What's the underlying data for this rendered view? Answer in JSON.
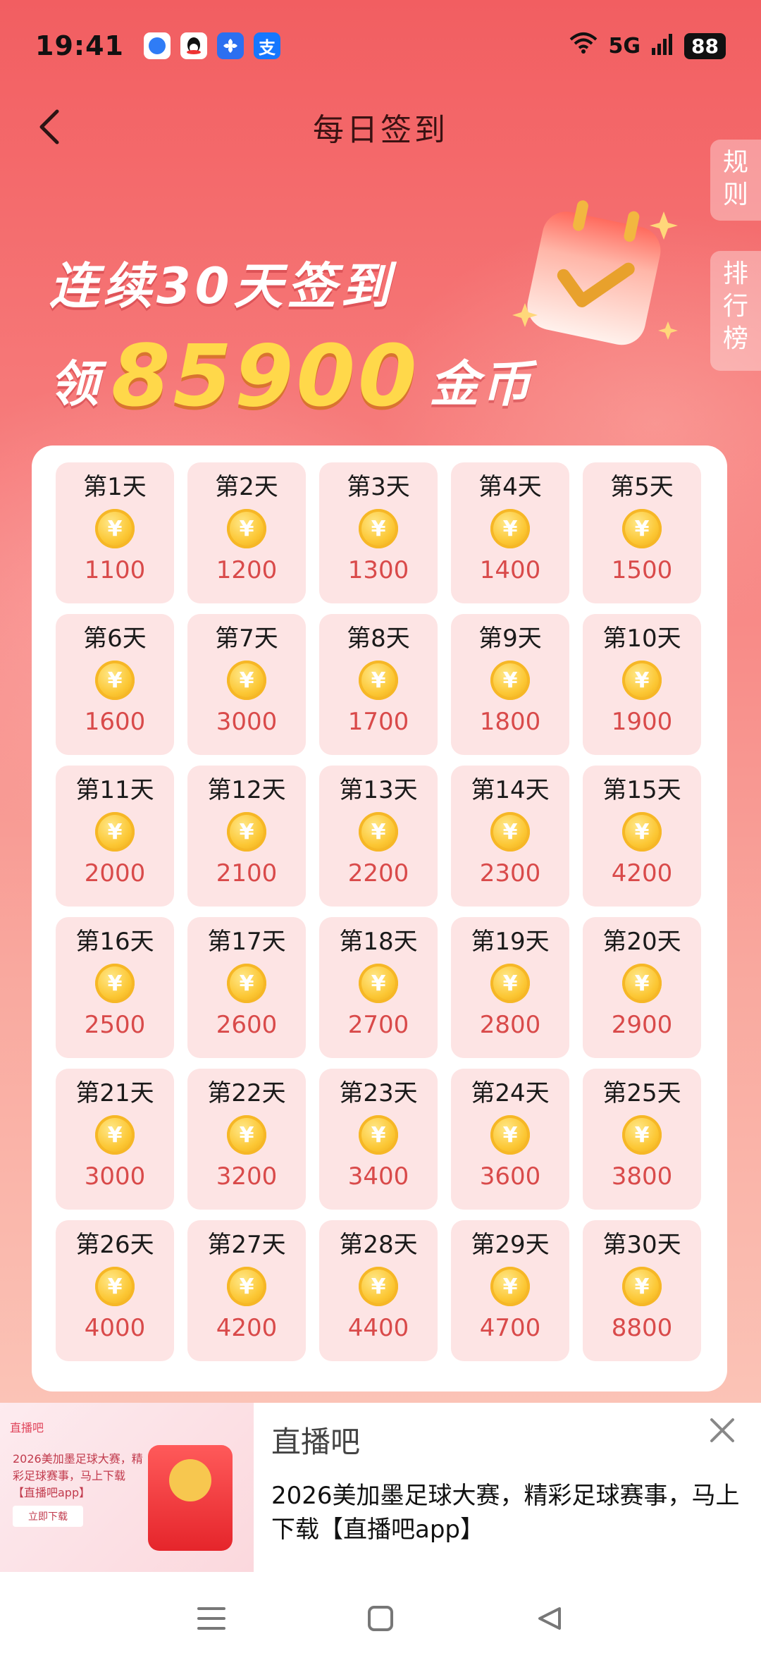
{
  "status_bar": {
    "time": "19:41",
    "notification_icons": [
      "browser-icon",
      "qq-icon",
      "fan-app-icon",
      "alipay-icon"
    ],
    "alipay_glyph": "支",
    "network": "5G",
    "battery": "88"
  },
  "header": {
    "title": "每日签到"
  },
  "side_tabs": {
    "rules": "规\n则",
    "rank": "排\n行\n榜"
  },
  "banner": {
    "line1": "连续30天签到",
    "line2_prefix": "领",
    "line2_amount": "85900",
    "line2_suffix": "金币"
  },
  "coin_glyph": "¥",
  "days": [
    {
      "label": "第1天",
      "amount": "1100"
    },
    {
      "label": "第2天",
      "amount": "1200"
    },
    {
      "label": "第3天",
      "amount": "1300"
    },
    {
      "label": "第4天",
      "amount": "1400"
    },
    {
      "label": "第5天",
      "amount": "1500"
    },
    {
      "label": "第6天",
      "amount": "1600"
    },
    {
      "label": "第7天",
      "amount": "3000"
    },
    {
      "label": "第8天",
      "amount": "1700"
    },
    {
      "label": "第9天",
      "amount": "1800"
    },
    {
      "label": "第10天",
      "amount": "1900"
    },
    {
      "label": "第11天",
      "amount": "2000"
    },
    {
      "label": "第12天",
      "amount": "2100"
    },
    {
      "label": "第13天",
      "amount": "2200"
    },
    {
      "label": "第14天",
      "amount": "2300"
    },
    {
      "label": "第15天",
      "amount": "4200"
    },
    {
      "label": "第16天",
      "amount": "2500"
    },
    {
      "label": "第17天",
      "amount": "2600"
    },
    {
      "label": "第18天",
      "amount": "2700"
    },
    {
      "label": "第19天",
      "amount": "2800"
    },
    {
      "label": "第20天",
      "amount": "2900"
    },
    {
      "label": "第21天",
      "amount": "3000"
    },
    {
      "label": "第22天",
      "amount": "3200"
    },
    {
      "label": "第23天",
      "amount": "3400"
    },
    {
      "label": "第24天",
      "amount": "3600"
    },
    {
      "label": "第25天",
      "amount": "3800"
    },
    {
      "label": "第26天",
      "amount": "4000"
    },
    {
      "label": "第27天",
      "amount": "4200"
    },
    {
      "label": "第28天",
      "amount": "4400"
    },
    {
      "label": "第29天",
      "amount": "4700"
    },
    {
      "label": "第30天",
      "amount": "8800"
    }
  ],
  "ad": {
    "thumb_logo": "直播吧",
    "thumb_text": "2026美加墨足球大赛，精彩足球赛事，马上下载【直播吧app】",
    "thumb_button": "立即下载",
    "title": "直播吧",
    "description": "2026美加墨足球大赛，精彩足球赛事，马上下载【直播吧app】"
  },
  "colors": {
    "accent": "#f25e61",
    "cell_bg": "#fde4e4",
    "amount": "#d94a4a",
    "banner_amount": "#ffd84a"
  }
}
